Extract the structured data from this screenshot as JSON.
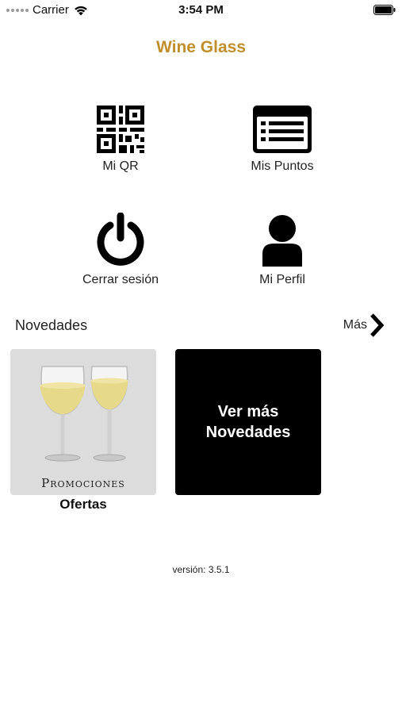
{
  "status_bar": {
    "carrier": "Carrier",
    "time": "3:54 PM",
    "icons": [
      "signal-dots-icon",
      "wifi-icon",
      "battery-icon"
    ]
  },
  "app": {
    "title": "Wine Glass",
    "title_color": "#c08f2c"
  },
  "menu": [
    {
      "label": "Mi QR",
      "icon": "qr-code-icon"
    },
    {
      "label": "Mis Puntos",
      "icon": "points-list-icon"
    },
    {
      "label": "Cerrar sesión",
      "icon": "power-icon"
    },
    {
      "label": "Mi Perfil",
      "icon": "user-icon"
    }
  ],
  "news": {
    "title": "Novedades",
    "more_label": "Más",
    "cards": [
      {
        "caption": "Promociones",
        "title": "Ofertas",
        "image": "wine-glasses-image"
      },
      {
        "text": "Ver más Novedades"
      }
    ]
  },
  "footer": {
    "version": "versión: 3.5.1"
  }
}
